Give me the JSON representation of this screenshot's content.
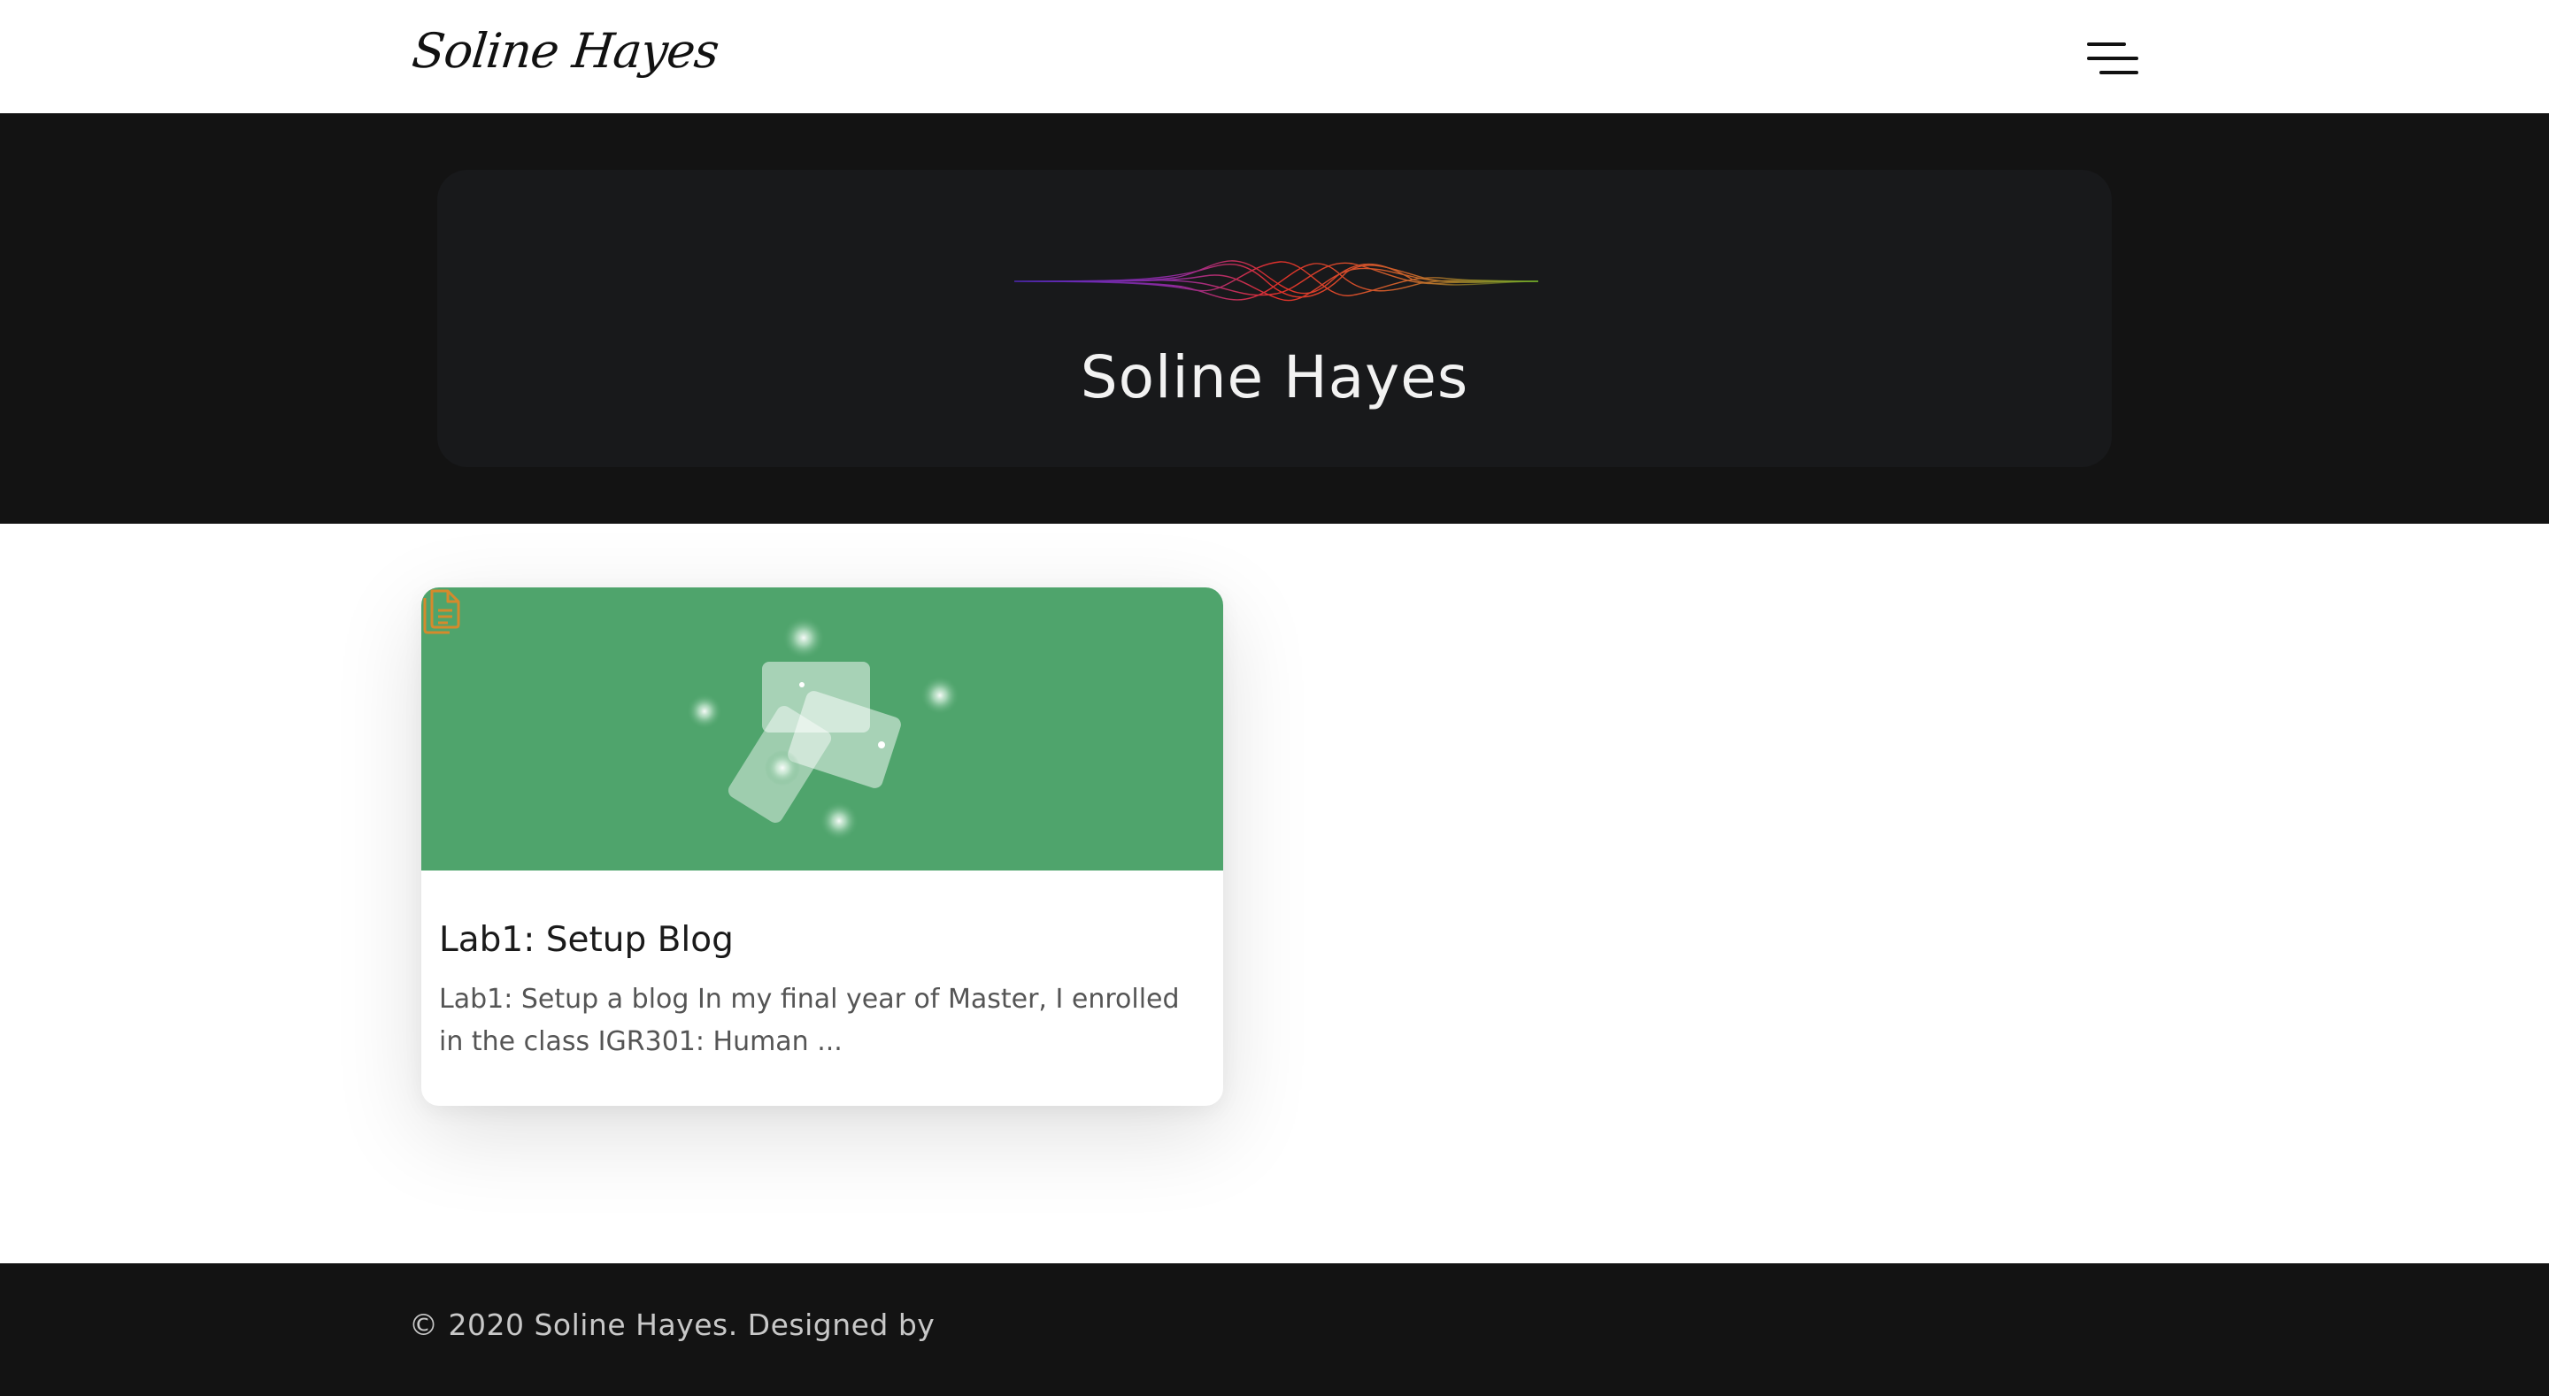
{
  "header": {
    "logo_text": "Soline Hayes",
    "menu_icon": "hamburger-menu-icon"
  },
  "hero": {
    "title": "Soline Hayes",
    "wave_colors": [
      "#5b2bd6",
      "#e0302a",
      "#7bbf2a"
    ]
  },
  "posts": [
    {
      "title": "Lab1: Setup Blog",
      "excerpt": "Lab1: Setup a blog In my final year of Master, I enrolled in the class IGR301: Human ...",
      "thumbnail_color": "#4fa46c",
      "type_icon": "document-icon",
      "type_icon_color": "#d58a2c"
    }
  ],
  "footer": {
    "copyright": "© 2020 Soline Hayes. Designed by"
  },
  "colors": {
    "header_bg": "#ffffff",
    "hero_bg": "#131313",
    "hero_card_bg": "#18191b",
    "footer_bg": "#131313"
  }
}
